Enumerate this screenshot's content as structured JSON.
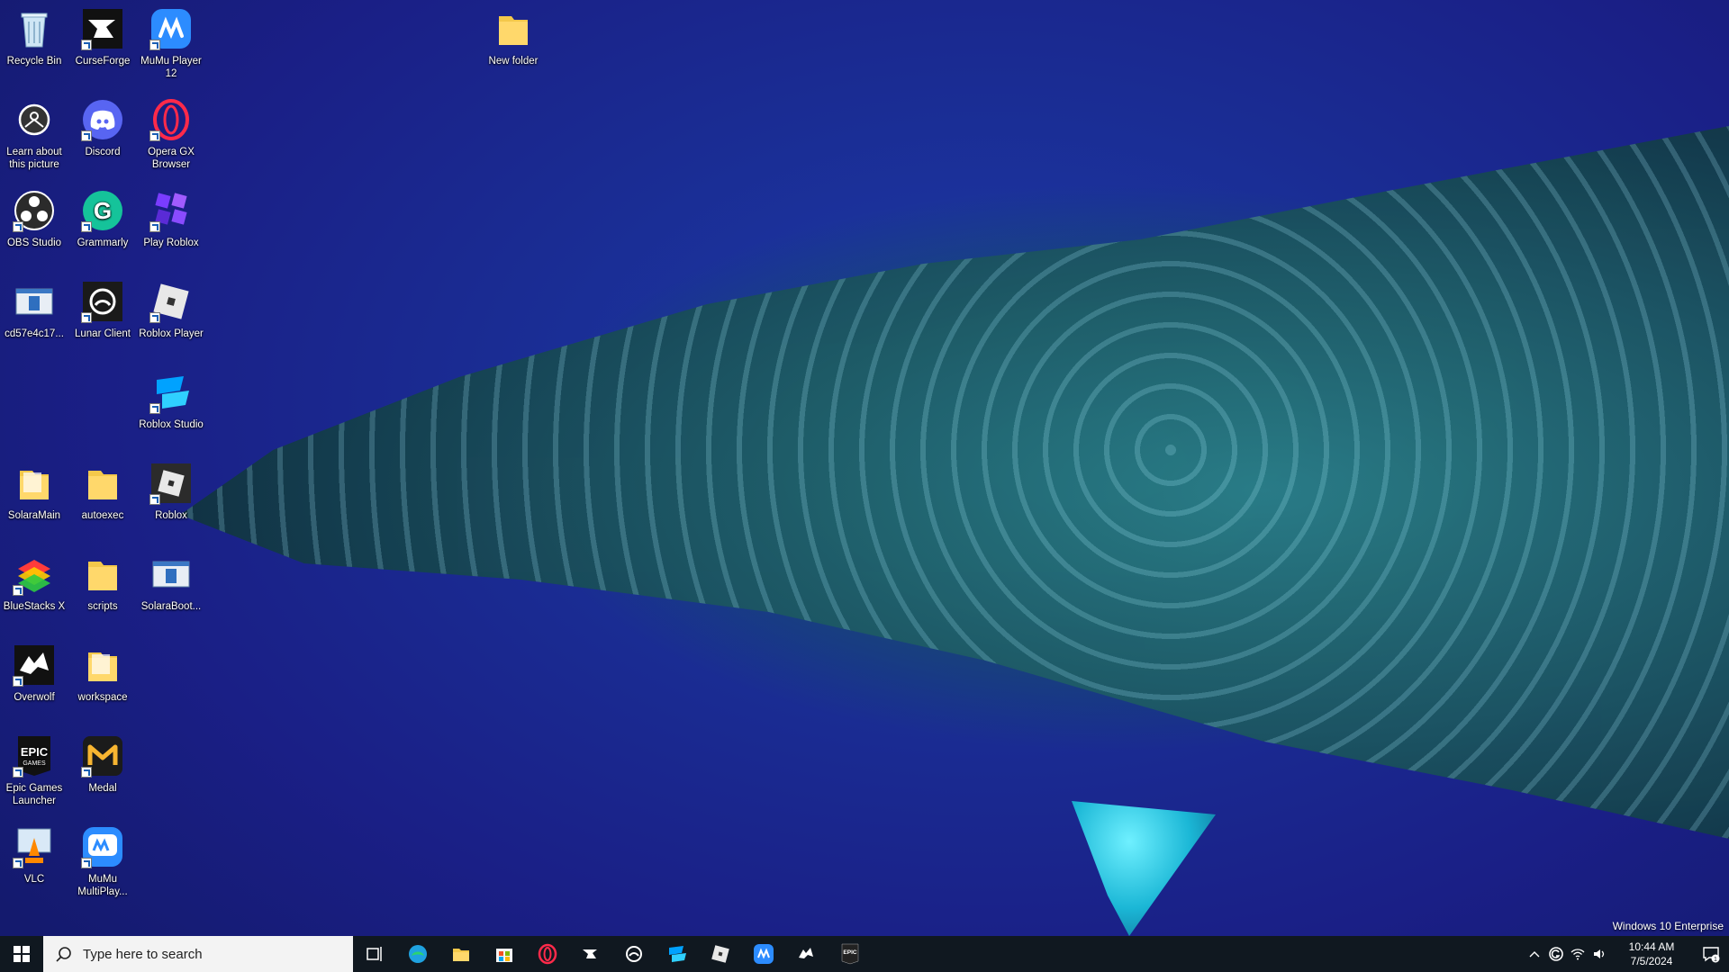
{
  "desktop": {
    "icons": [
      {
        "label": "Recycle Bin"
      },
      {
        "label": "CurseForge"
      },
      {
        "label": "MuMu Player 12"
      },
      {
        "label": "New folder"
      },
      {
        "label": "Learn about this picture"
      },
      {
        "label": "Discord"
      },
      {
        "label": "Opera GX Browser"
      },
      {
        "label": "OBS Studio"
      },
      {
        "label": "Grammarly"
      },
      {
        "label": "Play Roblox"
      },
      {
        "label": "cd57e4c17..."
      },
      {
        "label": "Lunar Client"
      },
      {
        "label": "Roblox Player"
      },
      {
        "label": "Roblox Studio"
      },
      {
        "label": "SolaraMain"
      },
      {
        "label": "autoexec"
      },
      {
        "label": "Roblox"
      },
      {
        "label": "BlueStacks X"
      },
      {
        "label": "scripts"
      },
      {
        "label": "SolaraBoot..."
      },
      {
        "label": "Overwolf"
      },
      {
        "label": "workspace"
      },
      {
        "label": "Epic Games Launcher"
      },
      {
        "label": "Medal"
      },
      {
        "label": "VLC"
      },
      {
        "label": "MuMu MultiPlay..."
      }
    ]
  },
  "watermark": "Windows 10 Enterprise",
  "taskbar": {
    "search_placeholder": "Type here to search",
    "apps": [
      "task-view",
      "edge",
      "file-explorer",
      "microsoft-store",
      "opera-gx",
      "curseforge",
      "lunar-client",
      "roblox-studio",
      "roblox-player",
      "mumu-player",
      "overwolf",
      "epic-games"
    ],
    "clock": {
      "time": "10:44 AM",
      "date": "7/5/2024"
    },
    "notification_count": "1"
  },
  "colors": {
    "taskbar_bg": "#101820",
    "accent": "#1a5fb4"
  }
}
